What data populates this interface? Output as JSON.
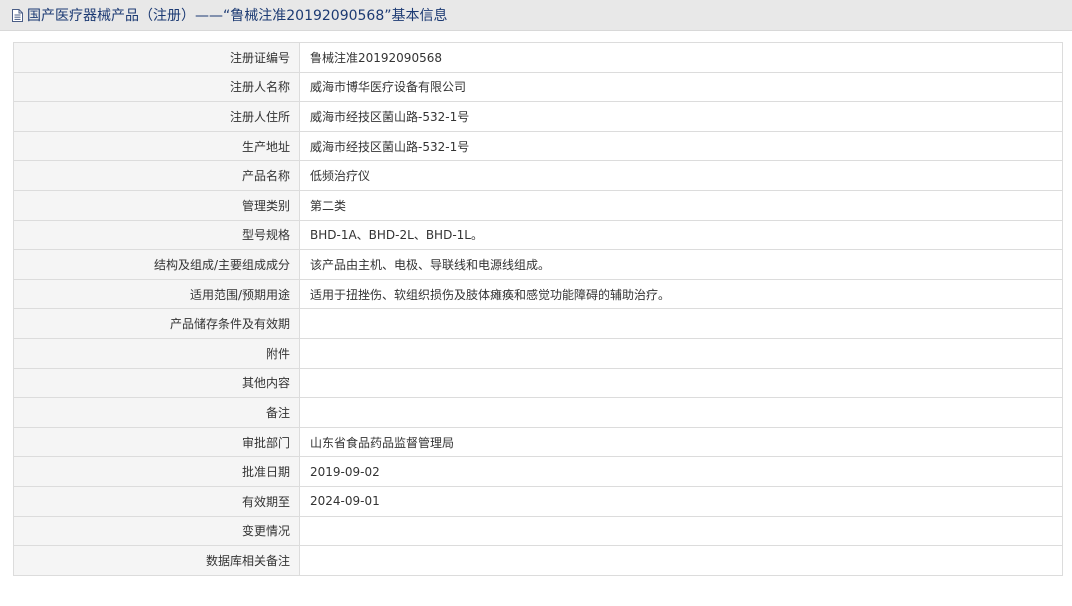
{
  "header": {
    "title": "国产医疗器械产品（注册）——“鲁械注准20192090568”基本信息",
    "icon": "document-icon"
  },
  "fields": [
    {
      "label": "注册证编号",
      "value": "鲁械注准20192090568"
    },
    {
      "label": "注册人名称",
      "value": "威海市博华医疗设备有限公司"
    },
    {
      "label": "注册人住所",
      "value": "威海市经技区菌山路-532-1号"
    },
    {
      "label": "生产地址",
      "value": "威海市经技区菌山路-532-1号"
    },
    {
      "label": "产品名称",
      "value": "低频治疗仪"
    },
    {
      "label": "管理类别",
      "value": "第二类"
    },
    {
      "label": "型号规格",
      "value": "BHD-1A、BHD-2L、BHD-1L。"
    },
    {
      "label": "结构及组成/主要组成成分",
      "value": "该产品由主机、电极、导联线和电源线组成。"
    },
    {
      "label": "适用范围/预期用途",
      "value": "适用于扭挫伤、软组织损伤及肢体瘫痪和感觉功能障碍的辅助治疗。"
    },
    {
      "label": "产品储存条件及有效期",
      "value": ""
    },
    {
      "label": "附件",
      "value": ""
    },
    {
      "label": "其他内容",
      "value": ""
    },
    {
      "label": "备注",
      "value": ""
    },
    {
      "label": "审批部门",
      "value": "山东省食品药品监督管理局"
    },
    {
      "label": "批准日期",
      "value": "2019-09-02"
    },
    {
      "label": "有效期至",
      "value": "2024-09-01"
    },
    {
      "label": "变更情况",
      "value": ""
    },
    {
      "label": "数据库相关备注",
      "value": ""
    }
  ]
}
